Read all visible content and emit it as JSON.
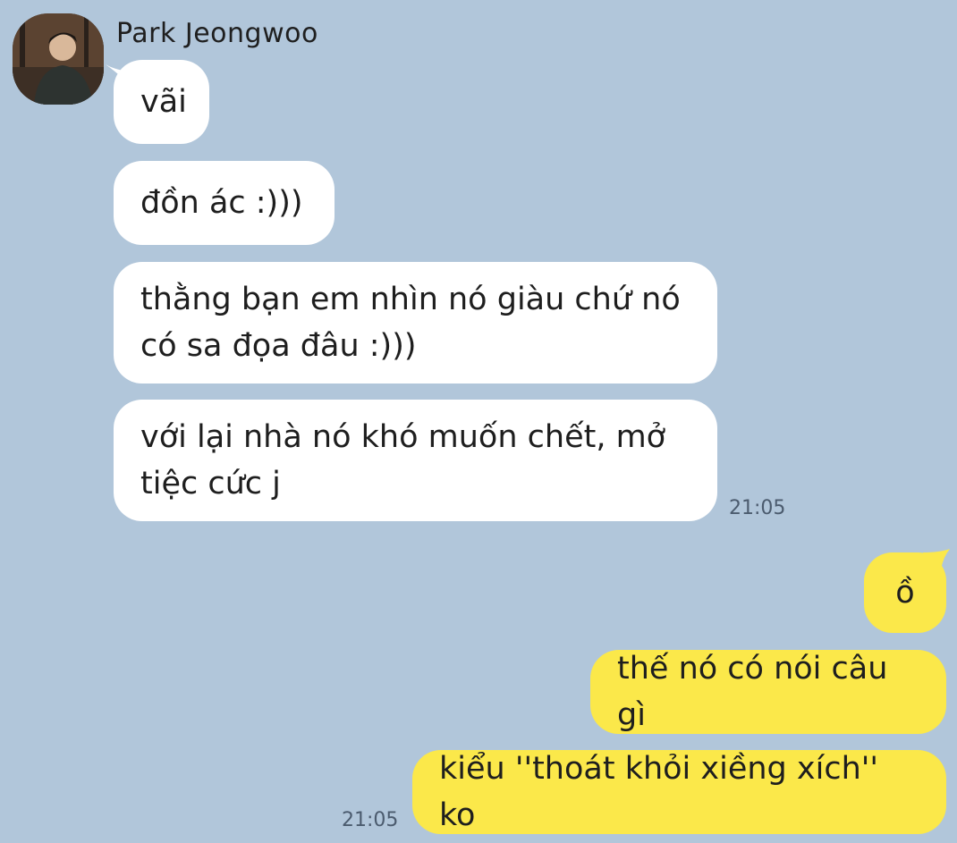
{
  "chat": {
    "sender_name": "Park Jeongwoo",
    "incoming": [
      {
        "text": "vãi"
      },
      {
        "text": "đồn ác :)))"
      },
      {
        "text": "thằng bạn em nhìn nó giàu chứ nó có sa đọa đâu :)))"
      },
      {
        "text": "với lại nhà nó khó muốn chết, mở tiệc cức j"
      }
    ],
    "incoming_time": "21:05",
    "outgoing": [
      {
        "text": "ồ"
      },
      {
        "text": "thế nó có nói câu gì"
      },
      {
        "text": "kiểu ''thoát khỏi xiềng xích'' ko"
      }
    ],
    "outgoing_time": "21:05"
  },
  "colors": {
    "background": "#b1c6da",
    "incoming_bubble": "#ffffff",
    "outgoing_bubble": "#fbe84a"
  }
}
